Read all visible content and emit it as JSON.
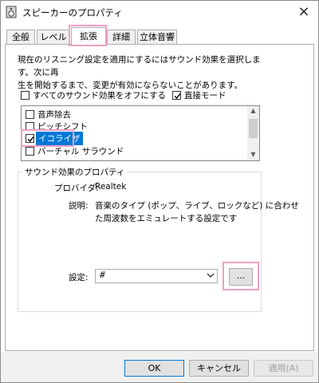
{
  "window": {
    "title": "スピーカーのプロパティ",
    "icon": "speaker-icon",
    "close_glyph": "×"
  },
  "tabs": [
    {
      "label": "全般",
      "active": false
    },
    {
      "label": "レベル",
      "active": false
    },
    {
      "label": "拡張",
      "active": true
    },
    {
      "label": "詳細",
      "active": false
    },
    {
      "label": "立体音響",
      "active": false
    }
  ],
  "enhancements": {
    "description_line1": "現在のリスニング設定を適用にするにはサウンド効果を選択します。次に再",
    "description_line2": "生を開始するまで、変更が有効にならないことがあります。",
    "disable_all_label": "すべてのサウンド効果をオフにする",
    "disable_all_checked": false,
    "immediate_mode_label": "直接モード",
    "immediate_mode_checked": true,
    "effects": [
      {
        "label": "音声除去",
        "checked": false,
        "selected": false
      },
      {
        "label": "ピッチシフト",
        "checked": false,
        "selected": false
      },
      {
        "label": "イコライザ",
        "checked": true,
        "selected": true
      },
      {
        "label": "バーチャル サラウンド",
        "checked": false,
        "selected": false
      }
    ],
    "properties": {
      "group_title": "サウンド効果のプロパティ",
      "provider_label": "プロバイダ:",
      "provider_value": "Realtek",
      "description_label": "説明:",
      "description_line1": "音楽のタイプ (ポップ、ライブ、ロックなど) に合わせ",
      "description_line2": "た周波数をエミュレートする設定です",
      "setting_label": "設定:",
      "setting_value": "#",
      "more_button": "..."
    }
  },
  "buttons": {
    "ok": "OK",
    "cancel": "キャンセル",
    "apply": "適用(A)"
  },
  "colors": {
    "highlight_outline": "#ef9fc4",
    "selection": "#0078d7"
  }
}
